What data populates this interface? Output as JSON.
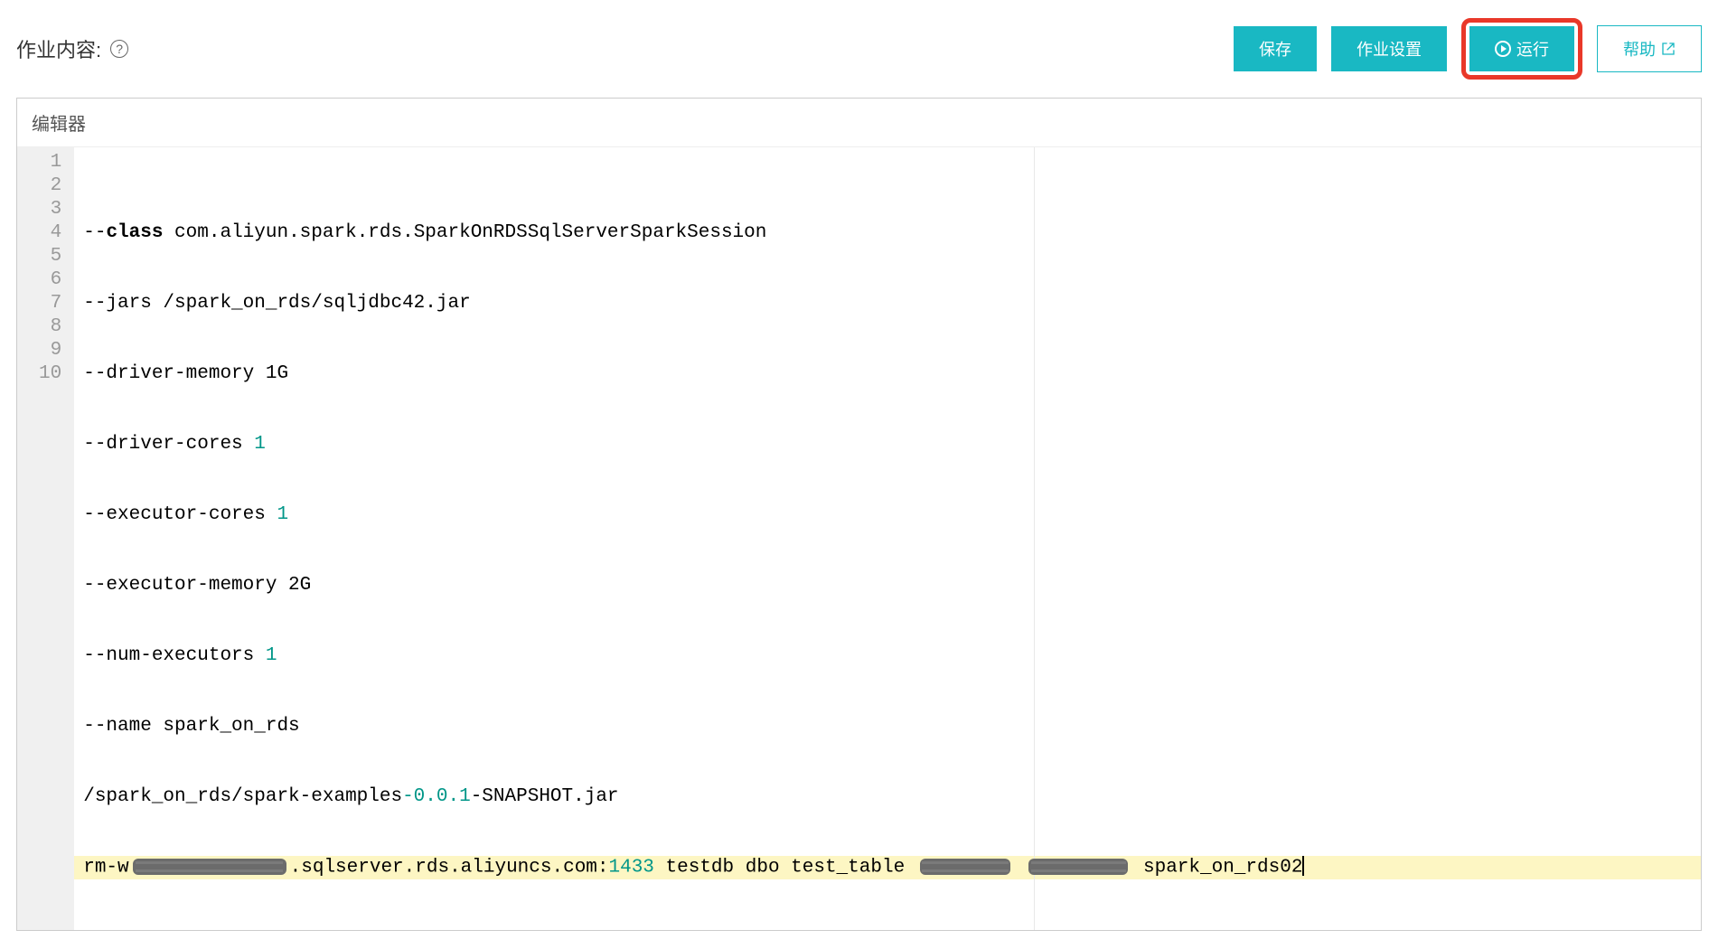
{
  "header": {
    "title": "作业内容:"
  },
  "buttons": {
    "save": "保存",
    "job_settings": "作业设置",
    "run": "运行",
    "help": "帮助"
  },
  "editor": {
    "tab_label": "编辑器",
    "lines": {
      "l1_prefix": "--",
      "l1_class": "class",
      "l1_rest": " com.aliyun.spark.rds.SparkOnRDSSqlServerSparkSession",
      "l2": "--jars /spark_on_rds/sqljdbc42.jar",
      "l3": "--driver-memory 1G",
      "l4_a": "--driver-cores ",
      "l4_n": "1",
      "l5_a": "--executor-cores ",
      "l5_n": "1",
      "l6": "--executor-memory 2G",
      "l7_a": "--num-executors ",
      "l7_n": "1",
      "l8": "--name spark_on_rds",
      "l9_a": "/spark_on_rds/spark-examples",
      "l9_v": "-0.0.1",
      "l9_b": "-SNAPSHOT.jar",
      "l10_a": "rm-w",
      "l10_b": ".sqlserver.rds.aliyuncs.com:",
      "l10_port": "1433",
      "l10_c": " testdb dbo test_table ",
      "l10_d": " spark_on_rds02"
    },
    "line_numbers": [
      "1",
      "2",
      "3",
      "4",
      "5",
      "6",
      "7",
      "8",
      "9",
      "10"
    ]
  }
}
